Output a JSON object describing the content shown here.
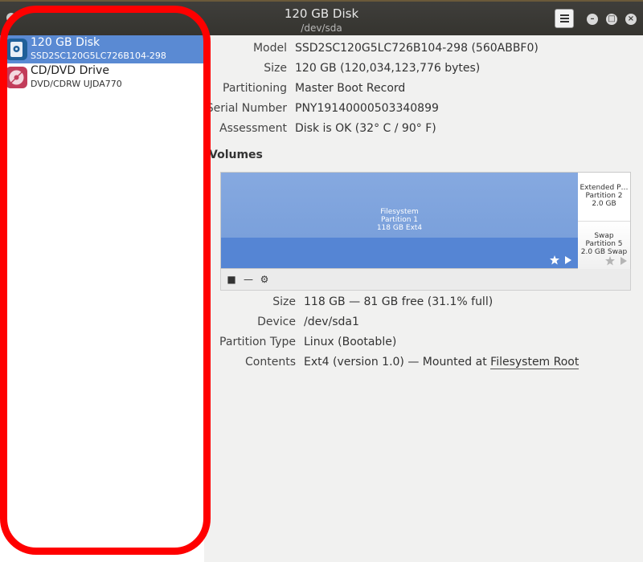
{
  "window": {
    "title": "120 GB Disk",
    "subtitle": "/dev/sda"
  },
  "sidebar": {
    "items": [
      {
        "label": "120 GB Disk",
        "sublabel": "SSD2SC120G5LC726B104-298",
        "icon": "disk-icon",
        "selected": true
      },
      {
        "label": "CD/DVD Drive",
        "sublabel": "DVD/CDRW UJDA770",
        "icon": "optical-drive-icon",
        "selected": false
      }
    ]
  },
  "disk": {
    "model_label": "Model",
    "model": "SSD2SC120G5LC726B104-298 (560ABBF0)",
    "size_label": "Size",
    "size": "120 GB (120,034,123,776 bytes)",
    "partitioning_label": "Partitioning",
    "partitioning": "Master Boot Record",
    "serial_label": "Serial Number",
    "serial": "PNY19140000503340899",
    "assessment_label": "Assessment",
    "assessment": "Disk is OK (32° C / 90° F)"
  },
  "volumes": {
    "heading": "Volumes",
    "main": {
      "line1": "Filesystem",
      "line2": "Partition 1",
      "line3": "118 GB Ext4"
    },
    "extended": {
      "line1": "Extended P…",
      "line2": "Partition 2",
      "line3": "2.0 GB"
    },
    "swap": {
      "line1": "Swap",
      "line2": "Partition 5",
      "line3": "2.0 GB Swap"
    }
  },
  "partition": {
    "size_label": "Size",
    "size": "118 GB — 81 GB free (31.1% full)",
    "device_label": "Device",
    "device": "/dev/sda1",
    "type_label": "Partition Type",
    "type": "Linux (Bootable)",
    "contents_label": "Contents",
    "contents_prefix": "Ext4 (version 1.0) — Mounted at ",
    "contents_link": "Filesystem Root"
  },
  "colors": {
    "selection": "#5a8ad3",
    "volume_fill": "#7aa0db",
    "highlight_circle": "#ff0000"
  }
}
